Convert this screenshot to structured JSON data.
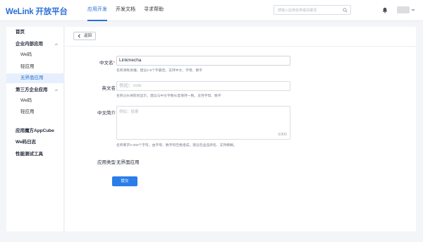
{
  "header": {
    "logo_main": "WeLink",
    "logo_sub": "开放平台",
    "nav": [
      "应用开发",
      "开发文档",
      "寻求帮助"
    ],
    "search_placeholder": "搜输入应用名称或关键词"
  },
  "sidebar": {
    "items": [
      {
        "label": "首页"
      },
      {
        "label": "企业内部应用"
      },
      {
        "label": "We码"
      },
      {
        "label": "轻应用"
      },
      {
        "label": "无界面应用"
      },
      {
        "label": "第三方企业应用"
      },
      {
        "label": "We码"
      },
      {
        "label": "轻应用"
      },
      {
        "label": "应用魔方AppCube"
      },
      {
        "label": "We码日志"
      },
      {
        "label": "性能测试工具"
      }
    ]
  },
  "form": {
    "back_label": "返回",
    "cn_name": {
      "label": "中文名",
      "required_mark": "*",
      "value": "Linkmecha",
      "hint": "名称清晰易懂，建议2-8个字最佳。支持中文、字母、数字"
    },
    "en_name": {
      "label": "英文名",
      "placeholder": "例如：vote",
      "hint": "名称过长将影响显示，建议与中文字数长度保持一致。支持字母、数字"
    },
    "cn_desc": {
      "label": "中文简介",
      "placeholder": "例如：投票",
      "counter": "0/300",
      "hint": "名称要求0-300个字符，由字母、数字和空格组成，建议包含品牌名、支持模糊。"
    },
    "app_type": {
      "label": "应用类型",
      "value": "无界面应用"
    },
    "submit_label": "提交"
  },
  "colors": {
    "brand": "#2b6fd6",
    "button": "#2b7de9",
    "sidebar_active_bg": "#e6f0fd",
    "required": "#e54545"
  }
}
